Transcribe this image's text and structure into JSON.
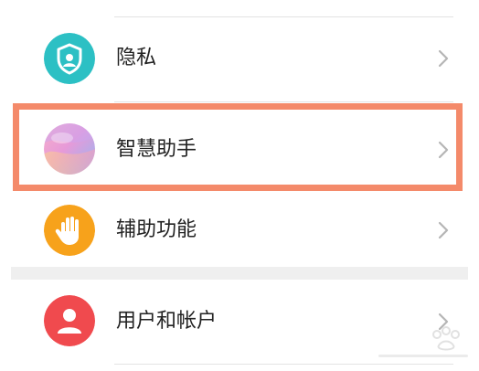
{
  "settings": {
    "items": [
      {
        "label": "隐私",
        "icon": "shield-user-icon",
        "icon_color": "#2cc0c4"
      },
      {
        "label": "智慧助手",
        "icon": "gradient-orb-icon",
        "icon_color": "#e8a0c8"
      },
      {
        "label": "辅助功能",
        "icon": "hand-icon",
        "icon_color": "#f7a21b"
      },
      {
        "label": "用户和帐户",
        "icon": "user-icon",
        "icon_color": "#f04a4e"
      }
    ]
  },
  "colors": {
    "highlight": "#f48a6a",
    "chevron": "#b5b5b5",
    "divider": "#e3e3e3"
  }
}
